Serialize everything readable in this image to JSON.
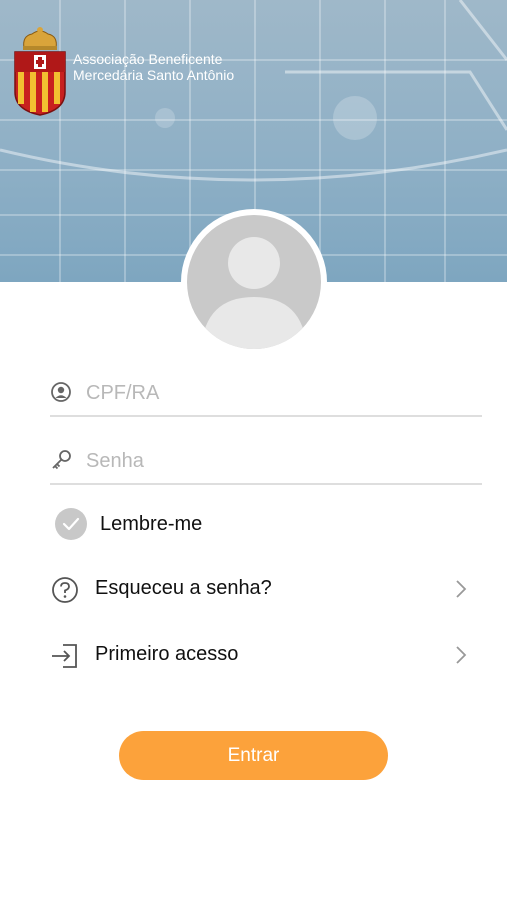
{
  "header": {
    "org_name_line1": "Associação Beneficente",
    "org_name_line2": "Mercedária Santo Antônio",
    "logo_icon": "crest-logo",
    "background_color": "#8fb0c6"
  },
  "avatar": {
    "icon": "user-avatar-icon"
  },
  "login": {
    "cpf_placeholder": "CPF/RA",
    "cpf_value": "",
    "senha_placeholder": "Senha",
    "senha_value": "",
    "remember_label": "Lembre-me",
    "forgot_label": "Esqueceu a senha?",
    "first_access_label": "Primeiro acesso",
    "submit_label": "Entrar"
  },
  "colors": {
    "accent": "#fca23b",
    "divider": "#dedede",
    "placeholder": "#b8b8b8"
  }
}
